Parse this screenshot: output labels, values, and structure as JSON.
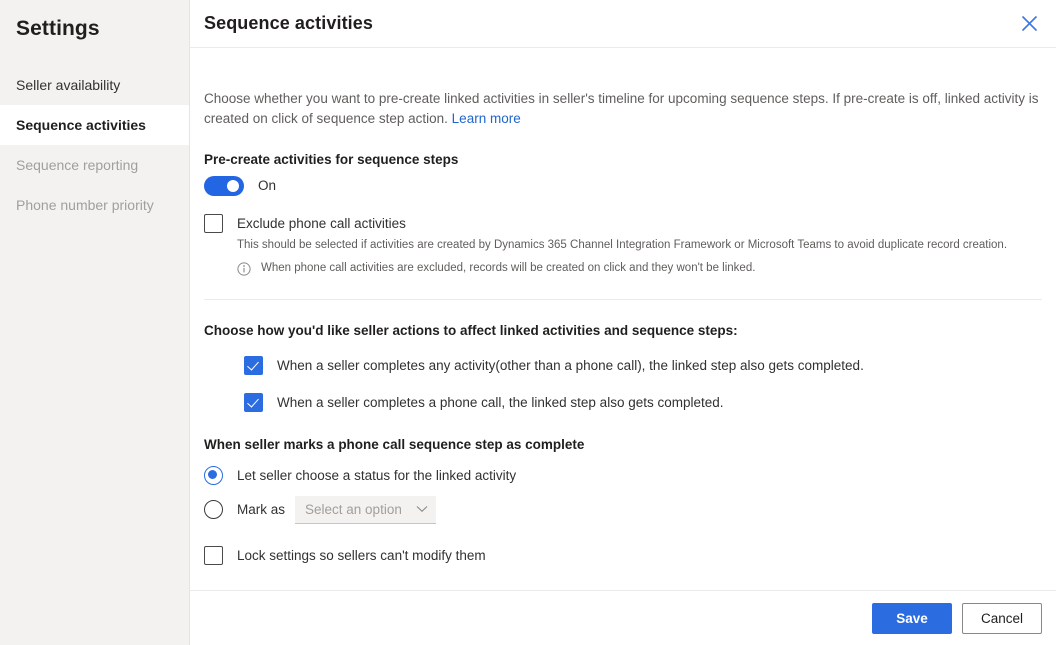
{
  "sidebar": {
    "title": "Settings",
    "items": [
      {
        "label": "Seller availability",
        "state": "normal"
      },
      {
        "label": "Sequence activities",
        "state": "selected"
      },
      {
        "label": "Sequence reporting",
        "state": "disabled"
      },
      {
        "label": "Phone number priority",
        "state": "disabled"
      }
    ]
  },
  "panel": {
    "title": "Sequence activities",
    "close_icon": "close-icon",
    "intro": {
      "text": "Choose whether you want to pre-create linked activities in seller's timeline for upcoming sequence steps. If pre-create is off, linked activity is created on click of sequence step action.",
      "link_label": "Learn more"
    },
    "precreate": {
      "label": "Pre-create activities for sequence steps",
      "toggle_state": "On",
      "toggle_on": true
    },
    "exclude_phone": {
      "label": "Exclude phone call activities",
      "checked": false,
      "helper": "This should be selected if activities are created by Dynamics 365 Channel Integration Framework or Microsoft Teams to avoid duplicate record creation.",
      "info_icon": "info-icon",
      "info_text": "When phone call activities are excluded, records will be created on click and they won't be linked."
    },
    "seller_actions": {
      "heading": "Choose how you'd like seller actions to affect linked activities and sequence steps:",
      "options": [
        {
          "label": "When a seller completes any activity(other than a phone call), the linked step also gets completed.",
          "checked": true
        },
        {
          "label": "When a seller completes a phone call, the linked step also gets completed.",
          "checked": true
        }
      ]
    },
    "phone_complete": {
      "heading": "When seller marks a phone call sequence step as complete",
      "radios": [
        {
          "label": "Let seller choose a status for the linked activity",
          "selected": true
        },
        {
          "label": "Mark as",
          "selected": false
        }
      ],
      "select": {
        "value": "Select an option",
        "chevron_icon": "chevron-down-icon",
        "disabled": true
      }
    },
    "lock_settings": {
      "label": "Lock settings so sellers can't modify them",
      "checked": false
    },
    "footer": {
      "save_label": "Save",
      "cancel_label": "Cancel"
    }
  },
  "colors": {
    "accent": "#2b6ce0",
    "link": "#2266cc",
    "sidebar_bg": "#f3f2f1",
    "divider": "#edebe9",
    "text_primary": "#201f1e",
    "text_secondary": "#605e5c",
    "text_disabled": "#a19f9d"
  }
}
